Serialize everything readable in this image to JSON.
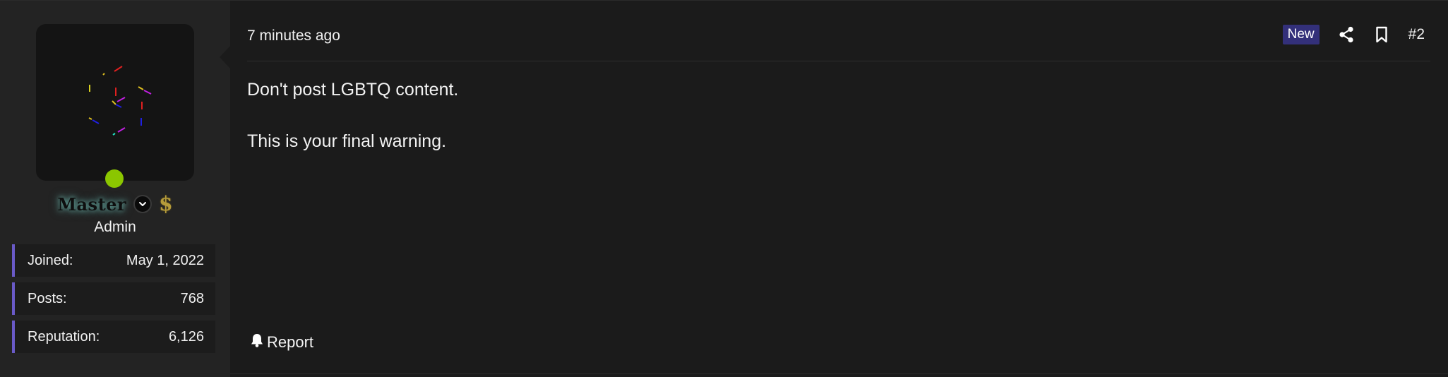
{
  "user": {
    "username": "Master",
    "title": "Admin",
    "online": true,
    "badges": [
      "verified-check-icon",
      "dollar-sign-icon"
    ],
    "stats": [
      {
        "label": "Joined:",
        "value": "May 1, 2022"
      },
      {
        "label": "Posts:",
        "value": "768"
      },
      {
        "label": "Reputation:",
        "value": "6,126"
      }
    ]
  },
  "post": {
    "time": "7 minutes ago",
    "badge": "New",
    "number": "#2",
    "paragraphs": [
      "Don't post LGBTQ content.",
      "This is your final warning."
    ],
    "report_label": "Report"
  },
  "colors": {
    "accent": "#6a5ac8",
    "new_badge": "#33307a",
    "online": "#8bc600",
    "background": "#1b1b1b",
    "sidebar": "#232323"
  }
}
